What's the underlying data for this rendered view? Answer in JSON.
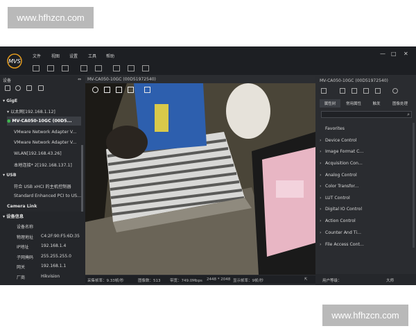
{
  "watermark": {
    "top": "www.hfhzcn.com",
    "bottom": "www.hfhzcn.com"
  },
  "app": {
    "logo_text": "MVS",
    "menu": [
      "文件",
      "视图",
      "设置",
      "工具",
      "帮助"
    ],
    "window_buttons": {
      "minimize": "—",
      "maximize": "□",
      "close": "✕"
    }
  },
  "left_panel": {
    "title": "设备",
    "pin": "⇔",
    "tree": {
      "gige_label": "GigE",
      "ethernet_label": "以太网[192.168.1.12]",
      "selected_device": "MV-CA050-10GC (00D5...",
      "adapters": [
        "VMware Network Adapter V...",
        "VMware Network Adapter V...",
        "WLAN[192.168.43.26]",
        "本地连接* 2[192.168.137.1]"
      ],
      "usb_label": "USB",
      "usb_items": [
        "符合 USB xHCI 的主机控制器",
        "Standard Enhanced PCI to US..."
      ],
      "camera_link_label": "Camera Link"
    },
    "info": {
      "title": "设备信息",
      "rows": [
        {
          "key": "设备名称",
          "value": ""
        },
        {
          "key": "物理地址",
          "value": "C4:2F:90:F5:6D:35"
        },
        {
          "key": "IP地址",
          "value": "192.168.1.4"
        },
        {
          "key": "子网掩码",
          "value": "255.255.255.0"
        },
        {
          "key": "网关",
          "value": "192.168.1.1"
        },
        {
          "key": "厂商",
          "value": "Hikvision"
        }
      ]
    }
  },
  "center": {
    "title": "MV-CA050-10GC (00D51972540)",
    "status": {
      "collect_rate": "采集帧率：9.33帧/秒",
      "image_count": "图像数：513",
      "bandwidth": "带宽：749.0Mbps",
      "resolution": "2448 * 2048",
      "display_rate": "显示帧率：9帧/秒"
    }
  },
  "right_panel": {
    "title": "MV-CA050-10GC (00D51972540)",
    "tabs": [
      "属性树",
      "常用属性",
      "触发",
      "图像处理"
    ],
    "categories": [
      "Favorites",
      "Device Control",
      "Image Format C...",
      "Acquisition Con...",
      "Analog Control",
      "Color Transfor...",
      "LUT Control",
      "Digital IO Control",
      "Action Control",
      "Counter And Ti...",
      "File Access Cont..."
    ],
    "footer_label": "用户等级：",
    "footer_value": "大师"
  },
  "colors": {
    "app_bg": "#2b2d31",
    "accent": "#ffcc00",
    "selected_row": "#3b3e44"
  }
}
